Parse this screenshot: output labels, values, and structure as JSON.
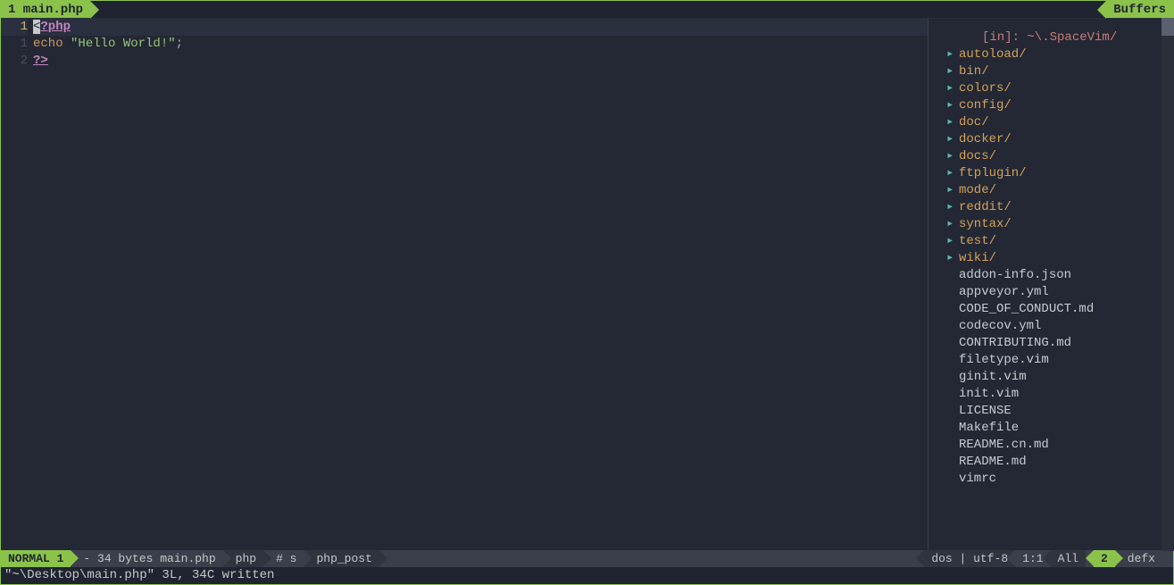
{
  "tabbar": {
    "left_tab": "1 main.php",
    "right_tab": "Buffers"
  },
  "editor": {
    "lines": [
      {
        "num": "1",
        "current": true
      },
      {
        "num": "1",
        "current": false
      },
      {
        "num": "2",
        "current": false
      }
    ],
    "code": {
      "line1_cursor": "<",
      "line1_tag": "?php",
      "line2_echo": "echo",
      "line2_string": "\"Hello World!\"",
      "line2_semi": ";",
      "line3_tag": "?>"
    }
  },
  "filetree": {
    "header": "[in]: ~\\.SpaceVim/",
    "folders": [
      "autoload/",
      "bin/",
      "colors/",
      "config/",
      "doc/",
      "docker/",
      "docs/",
      "ftplugin/",
      "mode/",
      "reddit/",
      "syntax/",
      "test/",
      "wiki/"
    ],
    "files": [
      "addon-info.json",
      "appveyor.yml",
      "CODE_OF_CONDUCT.md",
      "codecov.yml",
      "CONTRIBUTING.md",
      "filetype.vim",
      "ginit.vim",
      "init.vim",
      "LICENSE",
      "Makefile",
      "README.cn.md",
      "README.md",
      "vimrc"
    ]
  },
  "statusline": {
    "mode": "NORMAL 1",
    "fileinfo": "- 34 bytes main.php",
    "filetype": "php",
    "syntax": "# s",
    "post": "php_post",
    "format": "dos | utf-8",
    "position": "1:1",
    "percent": "All",
    "winnum": "2",
    "defx": "defx"
  },
  "commandline": {
    "message": "\"~\\Desktop\\main.php\" 3L, 34C written"
  }
}
